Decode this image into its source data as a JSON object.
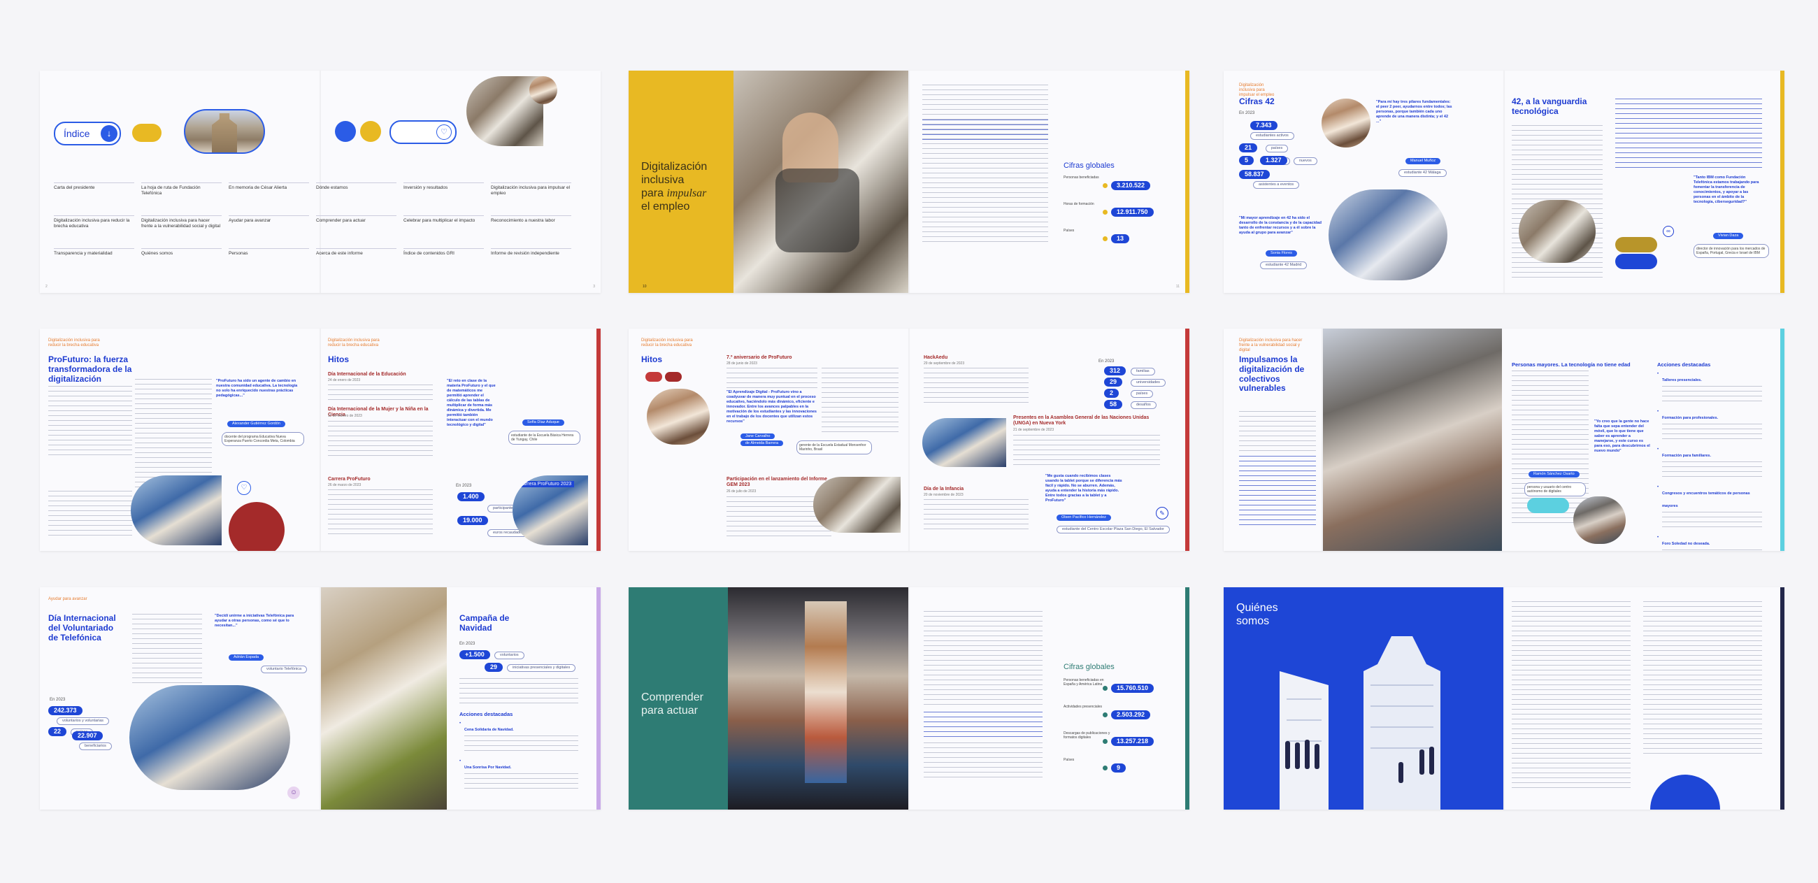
{
  "colors": {
    "blue": "#1d3bd1",
    "yellow": "#e8b923",
    "teal": "#2e7c74",
    "red": "#a42a2a",
    "orange": "#e67c2f",
    "cyan": "#5cd0e0",
    "lilac": "#c8a8e8",
    "navy": "#22264a",
    "pink": "#e36a88"
  },
  "s1": {
    "indice": "Índice",
    "grid": [
      [
        "Carta del presidente",
        "La hoja de ruta de Fundación Telefónica",
        "En memoria de César Alierta",
        "Dónde estamos",
        "Inversión y resultados",
        "Digitalización inclusiva para impulsar el empleo"
      ],
      [
        "Digitalización inclusiva para reducir la brecha educativa",
        "Digitalización inclusiva para hacer frente a la vulnerabilidad social y digital",
        "Ayudar para avanzar",
        "Comprender para actuar",
        "Celebrar para multiplicar el impacto",
        "Reconocimiento a nuestra labor"
      ],
      [
        "Transparencia y materialidad",
        "Quiénes somos",
        "Personas",
        "Acerca de este informe",
        "Índice de contenidos GRI",
        "Informe de revisión independiente"
      ]
    ]
  },
  "s2": {
    "t1": "Digitalización inclusiva",
    "t2": "para ",
    "t3": "impulsar",
    "t4": "el empleo",
    "cifras": "Cifras globales",
    "rows": [
      {
        "label": "Personas beneficiadas",
        "value": "3.210.522"
      },
      {
        "label": "Horas de formación",
        "value": "12.911.750"
      },
      {
        "label": "Países",
        "value": "13"
      }
    ]
  },
  "s3": {
    "tag": "Digitalización inclusiva para impulsar el empleo",
    "title": "Cifras 42",
    "year": "En 2023",
    "nums": [
      "7.343",
      "21",
      "5",
      "1.327",
      "58.837"
    ],
    "labels": [
      "estudiantes activos",
      "países",
      "campus",
      "nuevos",
      "asistentes a eventos"
    ],
    "quote": "\"Para mí hay tres pilares fundamentales: el peer 2 peer, ayudarnos entre todos; las personas, porque también cada uno aprende de una manera distinta; y el 42 ...\"",
    "person1": "Manuel Muñoz",
    "p1role": "estudiante 42 Málaga",
    "quote2": "\"Mi mayor aprendizaje en 42 ha sido el desarrollo de la constancia y de la capacidad tanto de enfrentar recursos y a él sobre la ayuda al grupo para avanzar\"",
    "person2": "Sonia Flores",
    "p2role": "estudiante 42 Madrid",
    "h2": "42, a la vanguardia tecnológica",
    "quote3": "\"Tanto IBM como Fundación Telefónica estamos trabajando para fomentar la transferencia de conocimientos, y apoyar a las personas en el ámbito de la tecnología, ciberseguridad?\"",
    "person3": "Vivian Daza",
    "p3role": "director de innovación para los mercados de España, Portugal, Grecia e Israel de IBM"
  },
  "s4": {
    "tag": "Digitalización inclusiva para reducir la brecha educativa",
    "title": "ProFuturo: la fuerza transformadora de la digitalización",
    "quote": "\"ProFuturo ha sido un agente de cambio en nuestra comunidad educativa. La tecnología no solo ha enriquecido nuestras prácticas pedagógicas...\"",
    "person": "Alexander Gutiérrez Gordón",
    "role": "docente del programa Educativa Nueva Esperanza Puerto Concordia Meta, Colombia",
    "tag2": "Digitalización inclusiva para reducir la brecha educativa",
    "hitos": "Hitos",
    "e1": "Día Internacional de la Educación",
    "d1": "24 de enero de 2023",
    "e2": "Día Internacional de la Mujer y la Niña en la Ciencia",
    "d2": "11 de febrero de 2023",
    "e3": "Carrera ProFuturo",
    "d3": "26 de marzo de 2023",
    "quote2": "\"El reto en clase de la materia ProFuturo y el que de matemáticos me permitió aprender el cálculo de las tablas de multiplicar de forma más dinámica y divertida. Me permitió también interactuar con el mundo tecnológico y digital\"",
    "person2": "Sofía Díaz Aduque",
    "role2": "estudiante de la Escuela Básica Herrera de Yungay, Chile",
    "year": "En 2023",
    "n1": "1.400",
    "l1": "participantes",
    "n2": "19.000",
    "l2": "euros recaudados",
    "banner": "Carrera ProFuturo 2023"
  },
  "s5": {
    "tag": "Digitalización inclusiva para reducir la brecha educativa",
    "hitos": "Hitos",
    "e1": "7.º aniversario de ProFuturo",
    "d1": "28 de junio de 2023",
    "quote": "\"El Aprendizaje Digital - ProFuturo vino a coadyuvar de manera muy puntual en el proceso educativo, haciéndolo más dinámico, eficiente e innovador. Entre los avances palpables en la motivación de los estudiantes y las innovaciones en el trabajo de los docentes que utilizan estos recursos\"",
    "person": "Jane Carvalho",
    "prole": "de Almeida Barrera",
    "role": "gerente de la Escuela Estadual Monsenhor Marinho, Brasil",
    "e2": "Participación en el lanzamiento del Informe GEM 2023",
    "d2": "26 de julio de 2023",
    "e3": "HackAedu",
    "d3": "29 de septiembre de 2023",
    "e4": "Presentes en la Asamblea General de las Naciones Unidas (UNGA) en Nueva York",
    "d4": "21 de septiembre de 2023",
    "e5": "Día de la Infancia",
    "d5": "20 de noviembre de 2023",
    "year": "En 2023",
    "nums": [
      "312",
      "29",
      "2",
      "58"
    ],
    "labels": [
      "familias",
      "universidades",
      "países",
      "desafíos"
    ],
    "quote2": "\"Me gusta cuando recibimos clases usando la tablet porque se diferencia más fácil y rápido. No se aburren. Además, ayuda a entender la historia más rápido. Entre todos gracias a la tablet y a ProFuturo\"",
    "person2": "Olsen Pacífico Hernández",
    "role2": "estudiante del Centro Escolar Plaza San Diego, El Salvador"
  },
  "s6": {
    "tag": "Digitalización inclusiva para hacer frente a la vulnerabilidad social y digital",
    "title": "Impulsamos la digitalización de colectivos vulnerables",
    "h2": "Personas mayores. La tecnología no tiene edad",
    "quote": "\"Yo creo que la gente no hace falta que sepa entender del móvil, que lo que tiene que saber es aprender a manejarse, y este curso es para eso, para descubrirnos el nuevo mundo\"",
    "person": "Ramón Sánchez Osarto",
    "role": "persona y usuario del centro autónomo de digitales",
    "acciones": "Acciones destacadas",
    "a": [
      "Talleres presenciales.",
      "Formación para profesionales.",
      "Formación para familiares.",
      "Congresos y encuentros temáticos de personas mayores",
      "Foro Soledad no deseada."
    ]
  },
  "s7": {
    "tag": "Ayudar para avanzar",
    "title": "Día Internacional del Voluntariado de Telefónica",
    "quote": "\"Decidí unirme a iniciativas Telefónica para ayudar a otras personas, como sé que lo necesitan...\"",
    "person": "Adrián Espada",
    "role": "voluntario Telefónica",
    "year": "En 2023",
    "nums": [
      "242.373",
      "22",
      "22.907"
    ],
    "labels": [
      "voluntarios y voluntarias",
      "países",
      "beneficiarios"
    ],
    "h2": "Campaña de Navidad",
    "year2": "En 2023",
    "n1": "+1.500",
    "l1": "voluntarios",
    "n2": "29",
    "l2": "iniciativas presenciales y digitales",
    "acciones": "Acciones destacadas",
    "a": [
      "Cena Solidaria de Navidad.",
      "Una Sonrisa Por Navidad."
    ]
  },
  "s8": {
    "t1": "Comprender",
    "t2": "para actuar",
    "cifras": "Cifras globales",
    "rows": [
      {
        "label": "Personas beneficiadas en España y América Latina",
        "value": "15.760.510"
      },
      {
        "label": "Actividades presenciales",
        "value": "2.503.292"
      },
      {
        "label": "Descargas de publicaciones y formatos digitales",
        "value": "13.257.218"
      },
      {
        "label": "Países",
        "value": "9"
      }
    ]
  },
  "s9": {
    "t1": "Quiénes",
    "t2": "somos"
  }
}
